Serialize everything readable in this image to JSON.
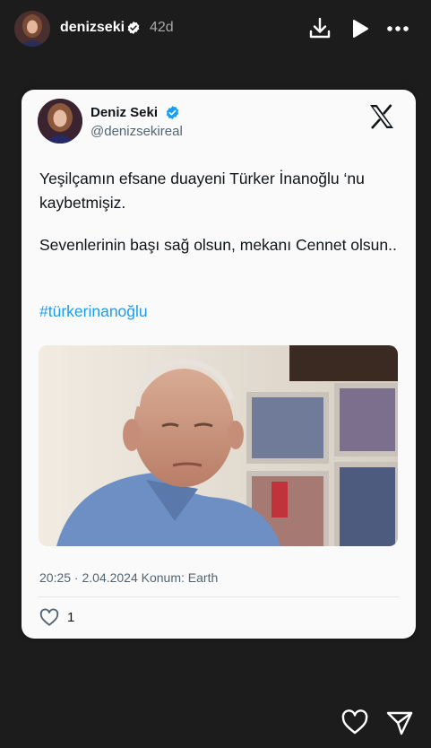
{
  "story": {
    "username": "denizseki",
    "age": "42d",
    "icons": [
      "verified-badge-icon",
      "download-icon",
      "play-icon",
      "more-icon",
      "heart-icon",
      "send-icon"
    ]
  },
  "post": {
    "author_name": "Deniz Seki",
    "author_handle": "@denizsekireal",
    "brand_icon": "x-logo-icon",
    "text_1": "Yeşilçamın efsane duayeni Türker İnanoğlu ‘nu kaybetmişiz.",
    "text_2": "Sevenlerinin başı sağ olsun, mekanı Cennet olsun..",
    "hashtag": "#türkerinanoğlu",
    "meta": "20:25 · 2.04.2024 Konum: Earth",
    "like_count": "1"
  },
  "colors": {
    "background": "#1c1c1c",
    "card": "#fafafa",
    "link": "#1d9bf0",
    "muted": "#536471"
  }
}
